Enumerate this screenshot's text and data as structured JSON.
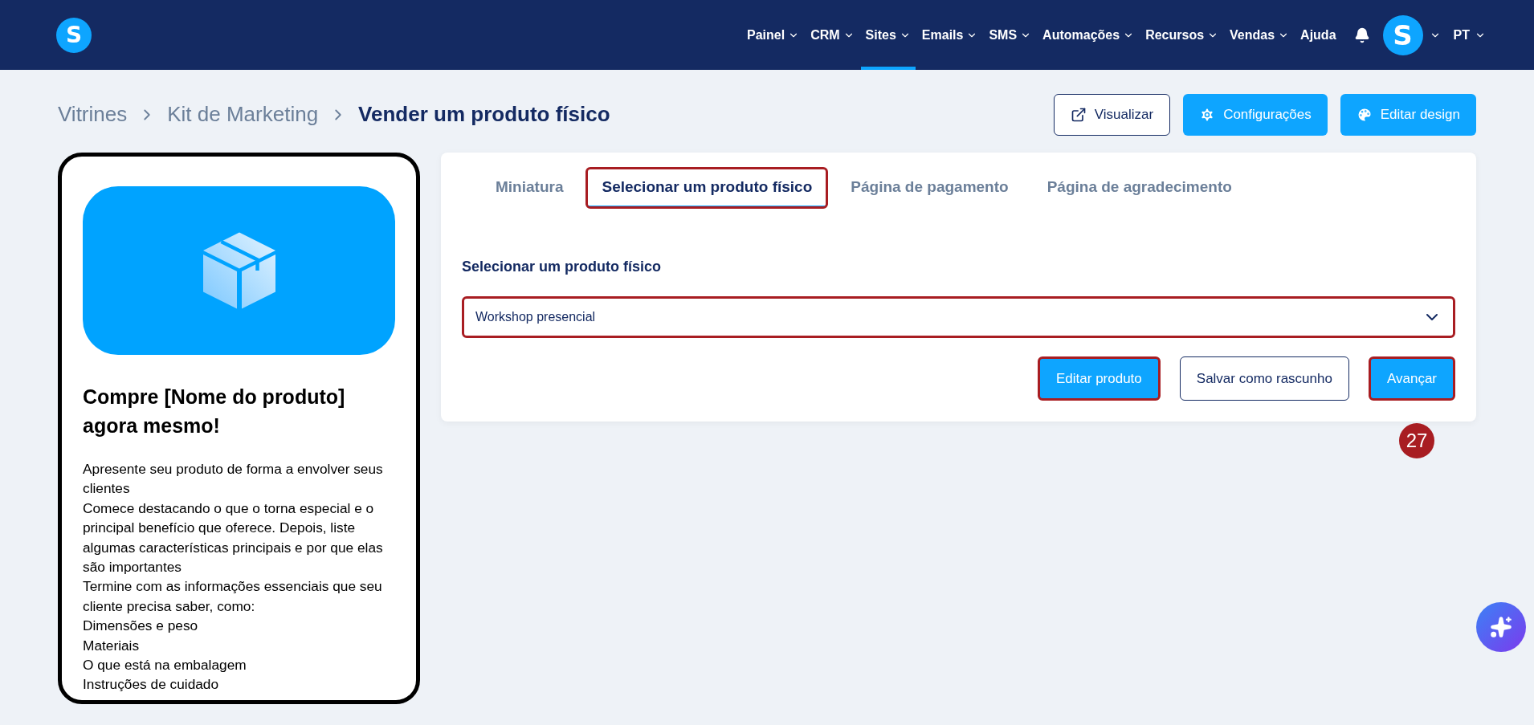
{
  "nav": {
    "logo": "S",
    "items": [
      {
        "label": "Painel",
        "selected": false,
        "has_menu": true
      },
      {
        "label": "CRM",
        "selected": false,
        "has_menu": true
      },
      {
        "label": "Sites",
        "selected": true,
        "has_menu": true
      },
      {
        "label": "Emails",
        "selected": false,
        "has_menu": true
      },
      {
        "label": "SMS",
        "selected": false,
        "has_menu": true
      },
      {
        "label": "Automações",
        "selected": false,
        "has_menu": true
      },
      {
        "label": "Recursos",
        "selected": false,
        "has_menu": true
      },
      {
        "label": "Vendas",
        "selected": false,
        "has_menu": true
      },
      {
        "label": "Ajuda",
        "selected": false,
        "has_menu": false
      }
    ],
    "avatar": "S",
    "language": "PT"
  },
  "breadcrumb": [
    "Vitrines",
    "Kit de Marketing",
    "Vender um produto físico"
  ],
  "header_buttons": [
    {
      "label": "Visualizar",
      "kind": "outline"
    },
    {
      "label": "Configurações",
      "kind": "settings"
    },
    {
      "label": "Editar design",
      "kind": "design"
    }
  ],
  "preview": {
    "title": "Compre [Nome do produto] agora mesmo!",
    "lines": [
      "Apresente seu produto de forma a envolver seus clientes",
      "Comece destacando o que o torna especial e o principal benefício que oferece. Depois, liste algumas características principais e por que elas são importantes",
      "Termine com as informações essenciais que seu cliente precisa saber, como:",
      "Dimensões e peso",
      "Materiais",
      "O que está na embalagem",
      "Instruções de cuidado"
    ]
  },
  "tabs": [
    {
      "label": "Miniatura",
      "selected": false,
      "highlighted": false
    },
    {
      "label": "Selecionar um produto físico",
      "selected": true,
      "highlighted": true
    },
    {
      "label": "Página de pagamento",
      "selected": false,
      "highlighted": false
    },
    {
      "label": "Página de agradecimento",
      "selected": false,
      "highlighted": false
    }
  ],
  "form": {
    "label": "Selecionar um produto físico",
    "select": {
      "value": "Workshop presencial",
      "highlighted": true
    },
    "buttons": [
      {
        "label": "Editar produto",
        "kind": "primary",
        "highlighted": true
      },
      {
        "label": "Salvar como rascunho",
        "kind": "outline",
        "highlighted": false
      },
      {
        "label": "Avançar",
        "kind": "primary",
        "highlighted": true
      }
    ]
  },
  "step_badge": "27"
}
